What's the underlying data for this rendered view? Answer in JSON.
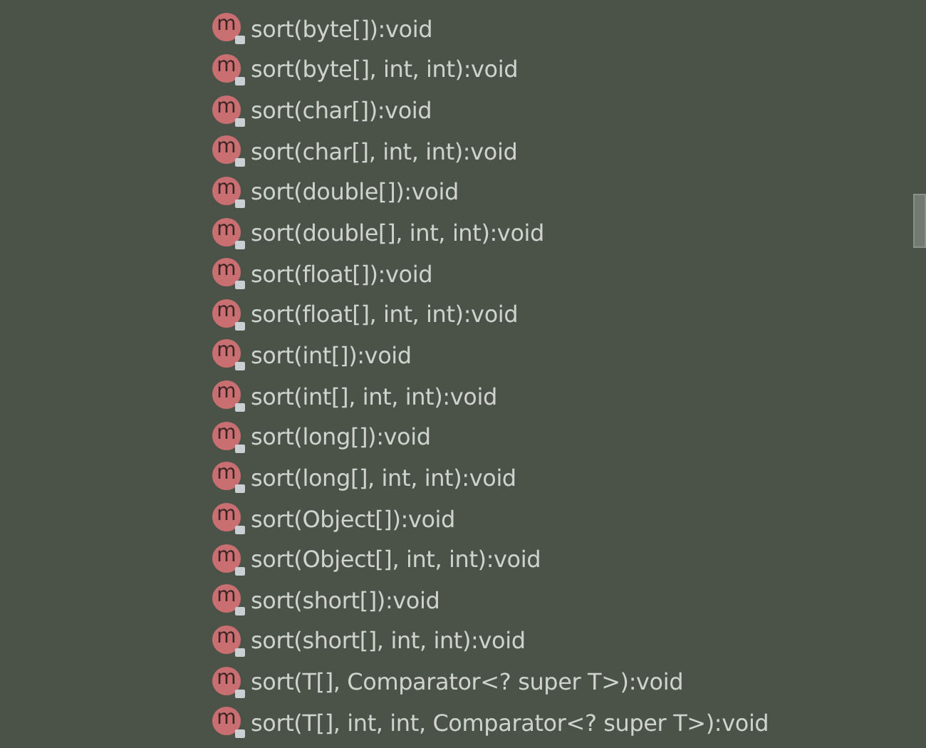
{
  "methods": [
    {
      "icon_letter": "m",
      "signature": "sort(byte[]):void"
    },
    {
      "icon_letter": "m",
      "signature": "sort(byte[], int, int):void"
    },
    {
      "icon_letter": "m",
      "signature": "sort(char[]):void"
    },
    {
      "icon_letter": "m",
      "signature": "sort(char[], int, int):void"
    },
    {
      "icon_letter": "m",
      "signature": "sort(double[]):void"
    },
    {
      "icon_letter": "m",
      "signature": "sort(double[], int, int):void"
    },
    {
      "icon_letter": "m",
      "signature": "sort(float[]):void"
    },
    {
      "icon_letter": "m",
      "signature": "sort(float[], int, int):void"
    },
    {
      "icon_letter": "m",
      "signature": "sort(int[]):void"
    },
    {
      "icon_letter": "m",
      "signature": "sort(int[], int, int):void"
    },
    {
      "icon_letter": "m",
      "signature": "sort(long[]):void"
    },
    {
      "icon_letter": "m",
      "signature": "sort(long[], int, int):void"
    },
    {
      "icon_letter": "m",
      "signature": "sort(Object[]):void"
    },
    {
      "icon_letter": "m",
      "signature": "sort(Object[], int, int):void"
    },
    {
      "icon_letter": "m",
      "signature": "sort(short[]):void"
    },
    {
      "icon_letter": "m",
      "signature": "sort(short[], int, int):void"
    },
    {
      "icon_letter": "m",
      "signature": "sort(T[], Comparator<? super T>):void"
    },
    {
      "icon_letter": "m",
      "signature": "sort(T[], int, int, Comparator<? super T>):void"
    }
  ]
}
